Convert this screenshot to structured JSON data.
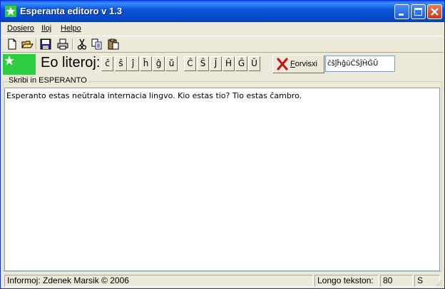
{
  "window": {
    "title": "Esperanta editoro v 1.3",
    "accent": "#0a56d8",
    "controls": [
      "minimize-icon",
      "maximize-icon",
      "close-icon"
    ]
  },
  "menu": [
    {
      "label": "Dosiero"
    },
    {
      "label": "Iloj"
    },
    {
      "label": "Helpo"
    }
  ],
  "toolbar": {
    "icons": [
      "new-file-icon",
      "open-folder-icon",
      "save-disk-icon",
      "print-icon",
      "cut-scissors-icon",
      "copy-icon",
      "paste-icon"
    ]
  },
  "charbar": {
    "logo_color": "#2ecc40",
    "label": "Eo literoj:",
    "lower_chars": [
      "ĉ",
      "ŝ",
      "ĵ",
      "ĥ",
      "ĝ",
      "ŭ"
    ],
    "upper_chars": [
      "Ĉ",
      "Ŝ",
      "Ĵ",
      "Ĥ",
      "Ĝ",
      "Ŭ"
    ],
    "clear_button": {
      "accel": "F",
      "rest": "orvisxi",
      "icon": "red-x-icon"
    },
    "char_field_value": "ĉŝĵĥĝŭĈŜĴĤĜŬ"
  },
  "editor": {
    "group_title": "Skribi in ESPERANTO",
    "text": "Esperanto estas neŭtrala internacia lingvo. Kio estas tio? Tio estas ĉambro."
  },
  "status": {
    "info": "Informoj: Zdenek Marsik © 2006",
    "length_label": "Longo tekston:",
    "length_value": "80",
    "mode": "S"
  }
}
